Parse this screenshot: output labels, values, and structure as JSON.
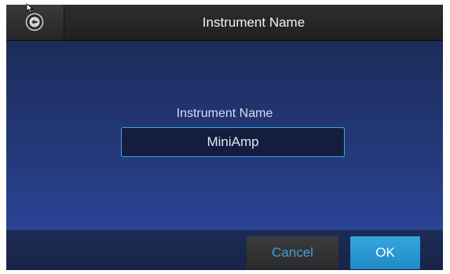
{
  "header": {
    "title": "Instrument Name",
    "back_icon": "back-arrow-icon"
  },
  "form": {
    "label": "Instrument Name",
    "value": "MiniAmp"
  },
  "footer": {
    "cancel_label": "Cancel",
    "ok_label": "OK"
  },
  "colors": {
    "accent": "#35a7de",
    "input_border": "#39a8e6",
    "background": "#1b2c57"
  }
}
